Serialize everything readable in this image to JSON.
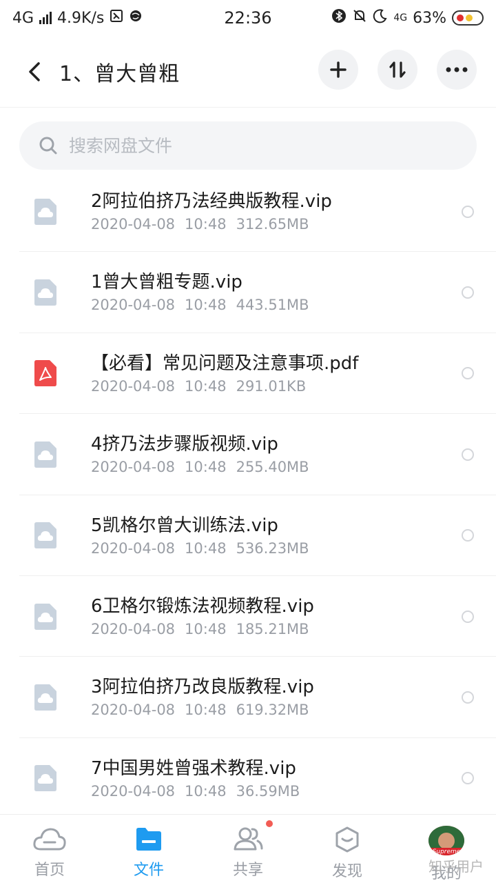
{
  "status_bar": {
    "network": "4G",
    "speed": "4.9K/s",
    "time": "22:36",
    "right_network": "4G",
    "battery": "63%"
  },
  "header": {
    "title": "1、曾大曾粗"
  },
  "search": {
    "placeholder": "搜索网盘文件"
  },
  "files": [
    {
      "name": "2阿拉伯挤乃法经典版教程.vip",
      "date": "2020-04-08",
      "time": "10:48",
      "size": "312.65MB",
      "type": "vip-icon"
    },
    {
      "name": "1曾大曾粗专题.vip",
      "date": "2020-04-08",
      "time": "10:48",
      "size": "443.51MB",
      "type": "vip-icon"
    },
    {
      "name": "【必看】常见问题及注意事项.pdf",
      "date": "2020-04-08",
      "time": "10:48",
      "size": "291.01KB",
      "type": "pdf-icon"
    },
    {
      "name": "4挤乃法步骤版视频.vip",
      "date": "2020-04-08",
      "time": "10:48",
      "size": "255.40MB",
      "type": "vip-icon"
    },
    {
      "name": "5凯格尔曾大训练法.vip",
      "date": "2020-04-08",
      "time": "10:48",
      "size": "536.23MB",
      "type": "vip-icon"
    },
    {
      "name": "6卫格尔锻炼法视频教程.vip",
      "date": "2020-04-08",
      "time": "10:48",
      "size": "185.21MB",
      "type": "vip-icon"
    },
    {
      "name": "3阿拉伯挤乃改良版教程.vip",
      "date": "2020-04-08",
      "time": "10:48",
      "size": "619.32MB",
      "type": "vip-icon"
    },
    {
      "name": "7中国男姓曾强术教程.vip",
      "date": "2020-04-08",
      "time": "10:48",
      "size": "36.59MB",
      "type": "vip-icon"
    }
  ],
  "bottom_nav": [
    {
      "label": "首页",
      "icon": "cloud-icon"
    },
    {
      "label": "文件",
      "icon": "folder-icon",
      "active": true
    },
    {
      "label": "共享",
      "icon": "people-icon"
    },
    {
      "label": "发现",
      "icon": "discover-icon"
    },
    {
      "label": "我的",
      "icon": "avatar"
    }
  ],
  "avatar_text": "Supreme",
  "watermark": "知乎用户",
  "colors": {
    "accent": "#1e9bf0",
    "pdf_red": "#ef4b4b",
    "file_icon": "#c9d3de",
    "badge_red": "#f25c54"
  }
}
